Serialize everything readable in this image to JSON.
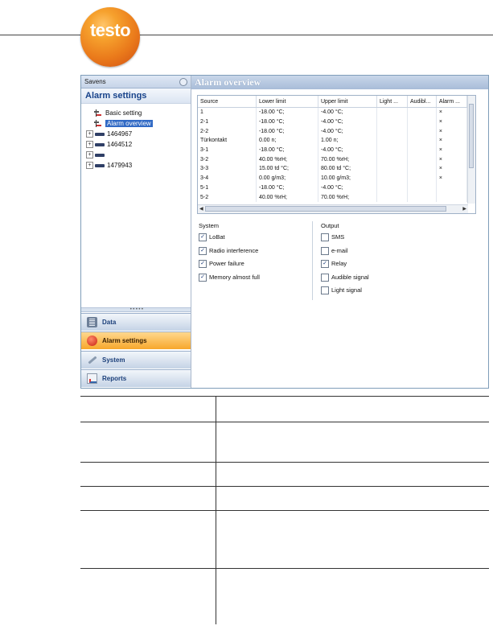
{
  "brand": {
    "logo_text": "testo"
  },
  "sidebar": {
    "panel_title": "Savens",
    "header": "Alarm settings",
    "tree": [
      {
        "label": "Basic setting",
        "type": "setting",
        "selected": false
      },
      {
        "label": "Alarm overview",
        "type": "setting",
        "selected": true
      },
      {
        "label": "1464967",
        "type": "logger"
      },
      {
        "label": "1464512",
        "type": "logger"
      },
      {
        "label": "",
        "type": "logger"
      },
      {
        "label": "1479943",
        "type": "logger"
      }
    ],
    "nav": [
      {
        "label": "Data",
        "icon": "data-icon",
        "active": false
      },
      {
        "label": "Alarm settings",
        "icon": "alarm-icon",
        "active": true
      },
      {
        "label": "System",
        "icon": "system-wrench-icon",
        "active": false
      },
      {
        "label": "Reports",
        "icon": "reports-icon",
        "active": false
      }
    ]
  },
  "main": {
    "title": "Alarm overview",
    "table": {
      "columns": [
        "Source",
        "Lower limit",
        "Upper limit",
        "Light ...",
        "Audibl...",
        "Alarm ..."
      ],
      "rows": [
        [
          "1",
          "-18.00 °C;",
          "-4.00 °C;",
          "",
          "",
          "×"
        ],
        [
          "2-1",
          "-18.00 °C;",
          "-4.00 °C;",
          "",
          "",
          "×"
        ],
        [
          "2-2",
          "-18.00 °C;",
          "-4.00 °C;",
          "",
          "",
          "×"
        ],
        [
          "Türkontakt",
          "0.00 n;",
          "1.00 n;",
          "",
          "",
          "×"
        ],
        [
          "3-1",
          "-18.00 °C;",
          "-4.00 °C;",
          "",
          "",
          "×"
        ],
        [
          "3-2",
          "40.00 %rH;",
          "70.00 %rH;",
          "",
          "",
          "×"
        ],
        [
          "3-3",
          "15.00 td °C;",
          "80.00 td °C;",
          "",
          "",
          "×"
        ],
        [
          "3-4",
          "0.00 g/m3;",
          "10.00 g/m3;",
          "",
          "",
          "×"
        ],
        [
          "5-1",
          "-18.00 °C;",
          "-4.00 °C;",
          "",
          "",
          ""
        ],
        [
          "5-2",
          "40.00 %rH;",
          "70.00 %rH;",
          "",
          "",
          ""
        ]
      ]
    },
    "system_group": {
      "title": "System",
      "items": [
        {
          "label": "LoBat",
          "checked": true
        },
        {
          "label": "Radio interference",
          "checked": true
        },
        {
          "label": "Power failure",
          "checked": true
        },
        {
          "label": "Memory almost full",
          "checked": true
        }
      ]
    },
    "output_group": {
      "title": "Output",
      "items": [
        {
          "label": "SMS",
          "checked": false
        },
        {
          "label": "e-mail",
          "checked": false
        },
        {
          "label": "Relay",
          "checked": true
        },
        {
          "label": "Audible signal",
          "checked": false
        },
        {
          "label": "Light signal",
          "checked": false
        }
      ]
    }
  },
  "colors": {
    "accent_orange": "#f7a72c",
    "header_blue": "#a8bcd8",
    "selection": "#316ac5"
  }
}
